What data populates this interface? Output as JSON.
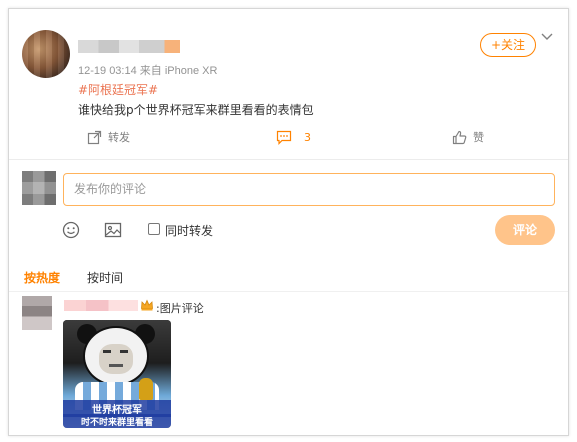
{
  "post": {
    "author_avatar": "avatar",
    "meta": "12-19 03:14  来自 iPhone XR",
    "follow_label": "+关注",
    "topic": "#阿根廷冠军#",
    "text": "谁快给我p个世界杯冠军来群里看看的表情包",
    "actions": {
      "repost_label": "转发",
      "comment_count": "3",
      "like_label": "赞"
    }
  },
  "composer": {
    "placeholder": "发布你的评论",
    "repost_option_label": "同时转发",
    "submit_label": "评论",
    "icons": [
      "emoji-icon",
      "image-icon"
    ]
  },
  "sort": {
    "tabs": [
      "按热度",
      "按时间"
    ],
    "active": "按热度"
  },
  "comments": [
    {
      "tag": ":图片评论",
      "meme_caption_line1": "世界杯冠军",
      "meme_caption_line2": "时不时来群里看看"
    }
  ],
  "colors": {
    "accent": "#ff8200",
    "topic": "#eb7350",
    "submit_disabled": "#ffc48a",
    "input_border": "#ffb35c"
  }
}
